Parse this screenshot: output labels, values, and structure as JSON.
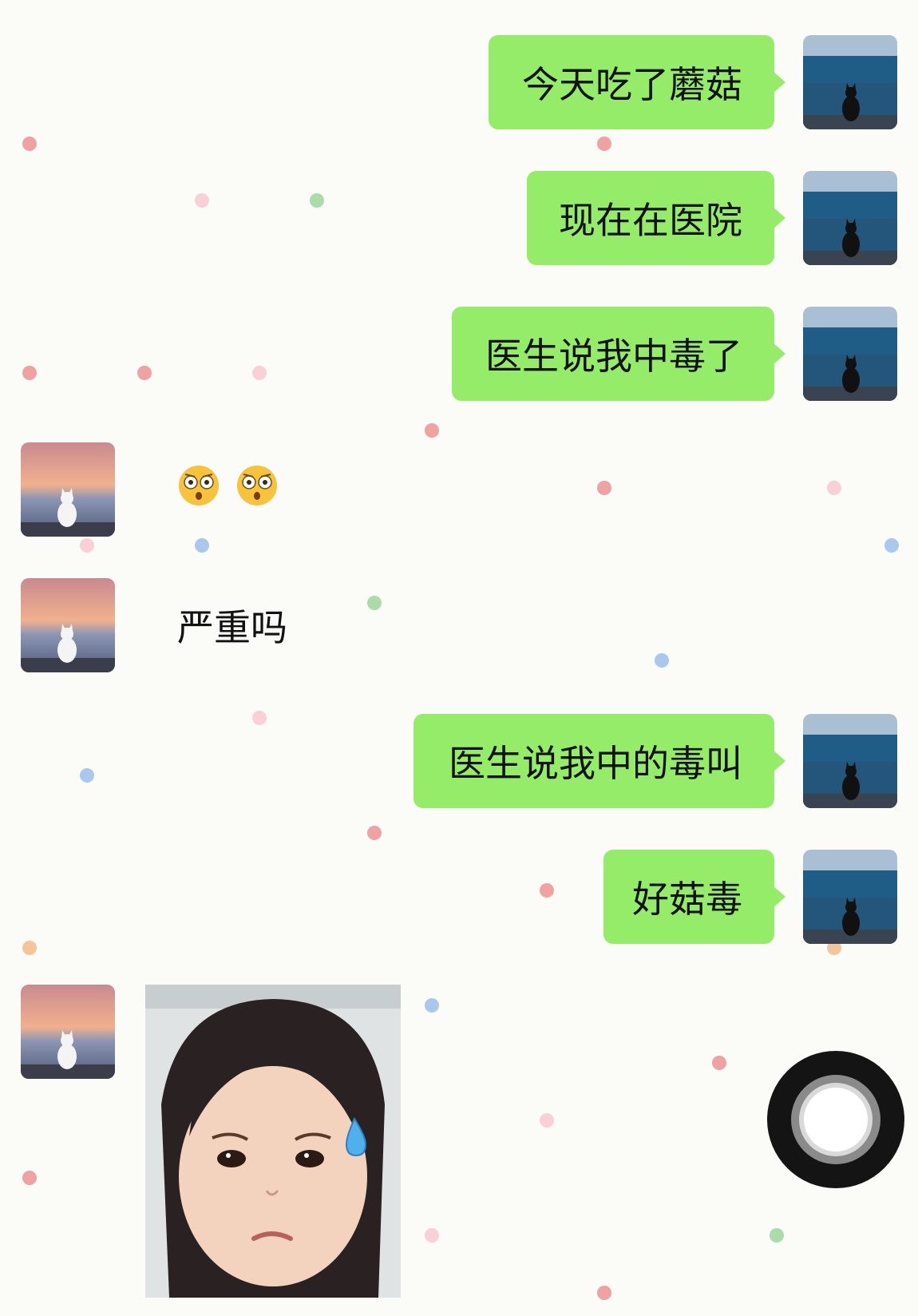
{
  "chat": {
    "messages": [
      {
        "side": "out",
        "type": "text",
        "text": "今天吃了蘑菇"
      },
      {
        "side": "out",
        "type": "text",
        "text": "现在在医院"
      },
      {
        "side": "out",
        "type": "text",
        "text": "医生说我中毒了"
      },
      {
        "side": "in",
        "type": "emoji",
        "emoji": "flushed-face-emoji ×2"
      },
      {
        "side": "in",
        "type": "text",
        "text": "严重吗"
      },
      {
        "side": "out",
        "type": "text",
        "text": "医生说我中的毒叫"
      },
      {
        "side": "out",
        "type": "text",
        "text": "好菇毒"
      },
      {
        "side": "in",
        "type": "sticker",
        "sticker": "girl-sweat-sticker"
      }
    ]
  },
  "avatars": {
    "self": "cat-sea-blue-avatar",
    "peer": "white-cat-sunset-avatar"
  },
  "floating_button": {
    "icon": "assistive-touch-icon"
  },
  "colors": {
    "outgoing_bubble": "#95ec69",
    "background": "#fbfbf8",
    "dot_palette": [
      "#f2a3a3",
      "#a9dfa9",
      "#a9c8ee",
      "#f5c49a",
      "#f7c7cf"
    ]
  }
}
